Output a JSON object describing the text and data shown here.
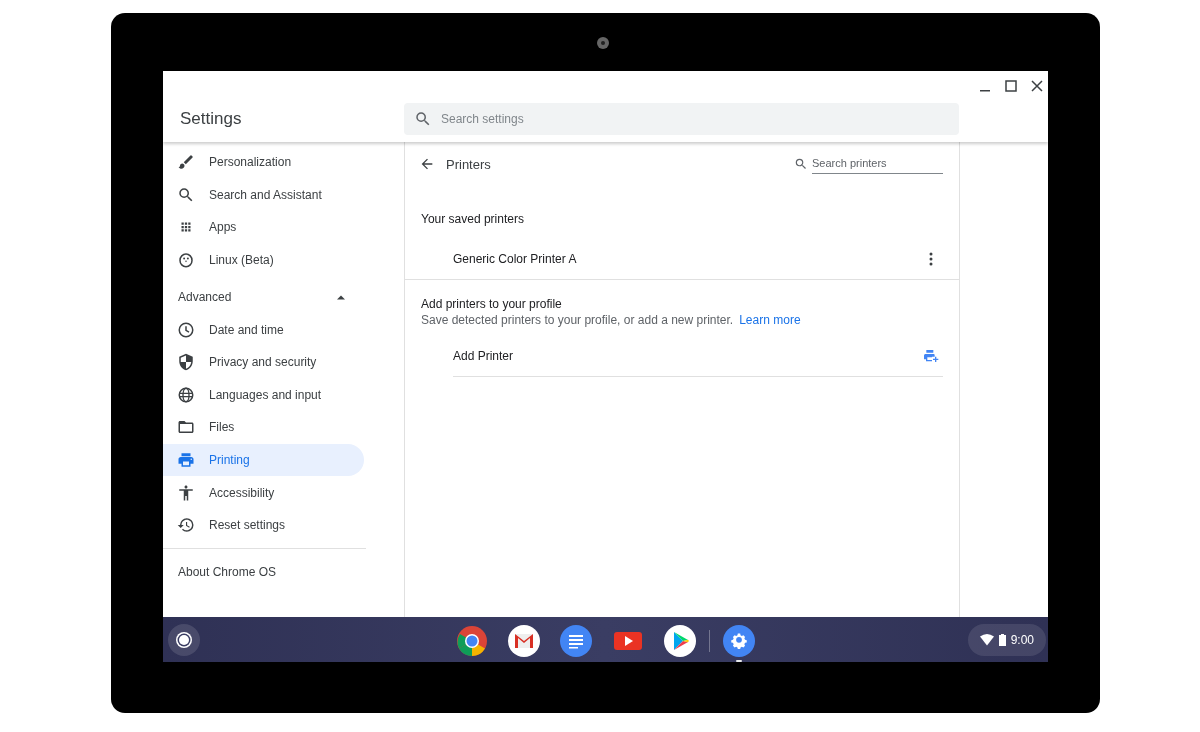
{
  "window": {
    "title": "Settings",
    "search": {
      "placeholder": "Search settings"
    }
  },
  "sidebar": {
    "items": [
      {
        "label": "Personalization",
        "selected": false
      },
      {
        "label": "Search and Assistant",
        "selected": false
      },
      {
        "label": "Apps",
        "selected": false
      },
      {
        "label": "Linux (Beta)",
        "selected": false
      }
    ],
    "advanced": {
      "label": "Advanced",
      "expanded": true
    },
    "advanced_items": [
      {
        "label": "Date and time",
        "selected": false
      },
      {
        "label": "Privacy and security",
        "selected": false
      },
      {
        "label": "Languages and input",
        "selected": false
      },
      {
        "label": "Files",
        "selected": false
      },
      {
        "label": "Printing",
        "selected": true
      },
      {
        "label": "Accessibility",
        "selected": false
      },
      {
        "label": "Reset settings",
        "selected": false
      }
    ],
    "about": "About Chrome OS"
  },
  "page": {
    "title": "Printers",
    "search": {
      "placeholder": "Search printers"
    },
    "saved_section": {
      "title": "Your saved printers",
      "printers": [
        {
          "name": "Generic Color Printer A"
        }
      ]
    },
    "add_section": {
      "title": "Add printers to your profile",
      "description": "Save detected printers to your profile, or add a new printer.",
      "link": "Learn more",
      "action": "Add Printer"
    }
  },
  "shelf": {
    "apps": [
      {
        "active": false
      },
      {
        "active": false
      },
      {
        "active": false
      },
      {
        "active": false
      },
      {
        "active": false
      },
      {
        "active": true
      }
    ],
    "time": "9:00"
  }
}
